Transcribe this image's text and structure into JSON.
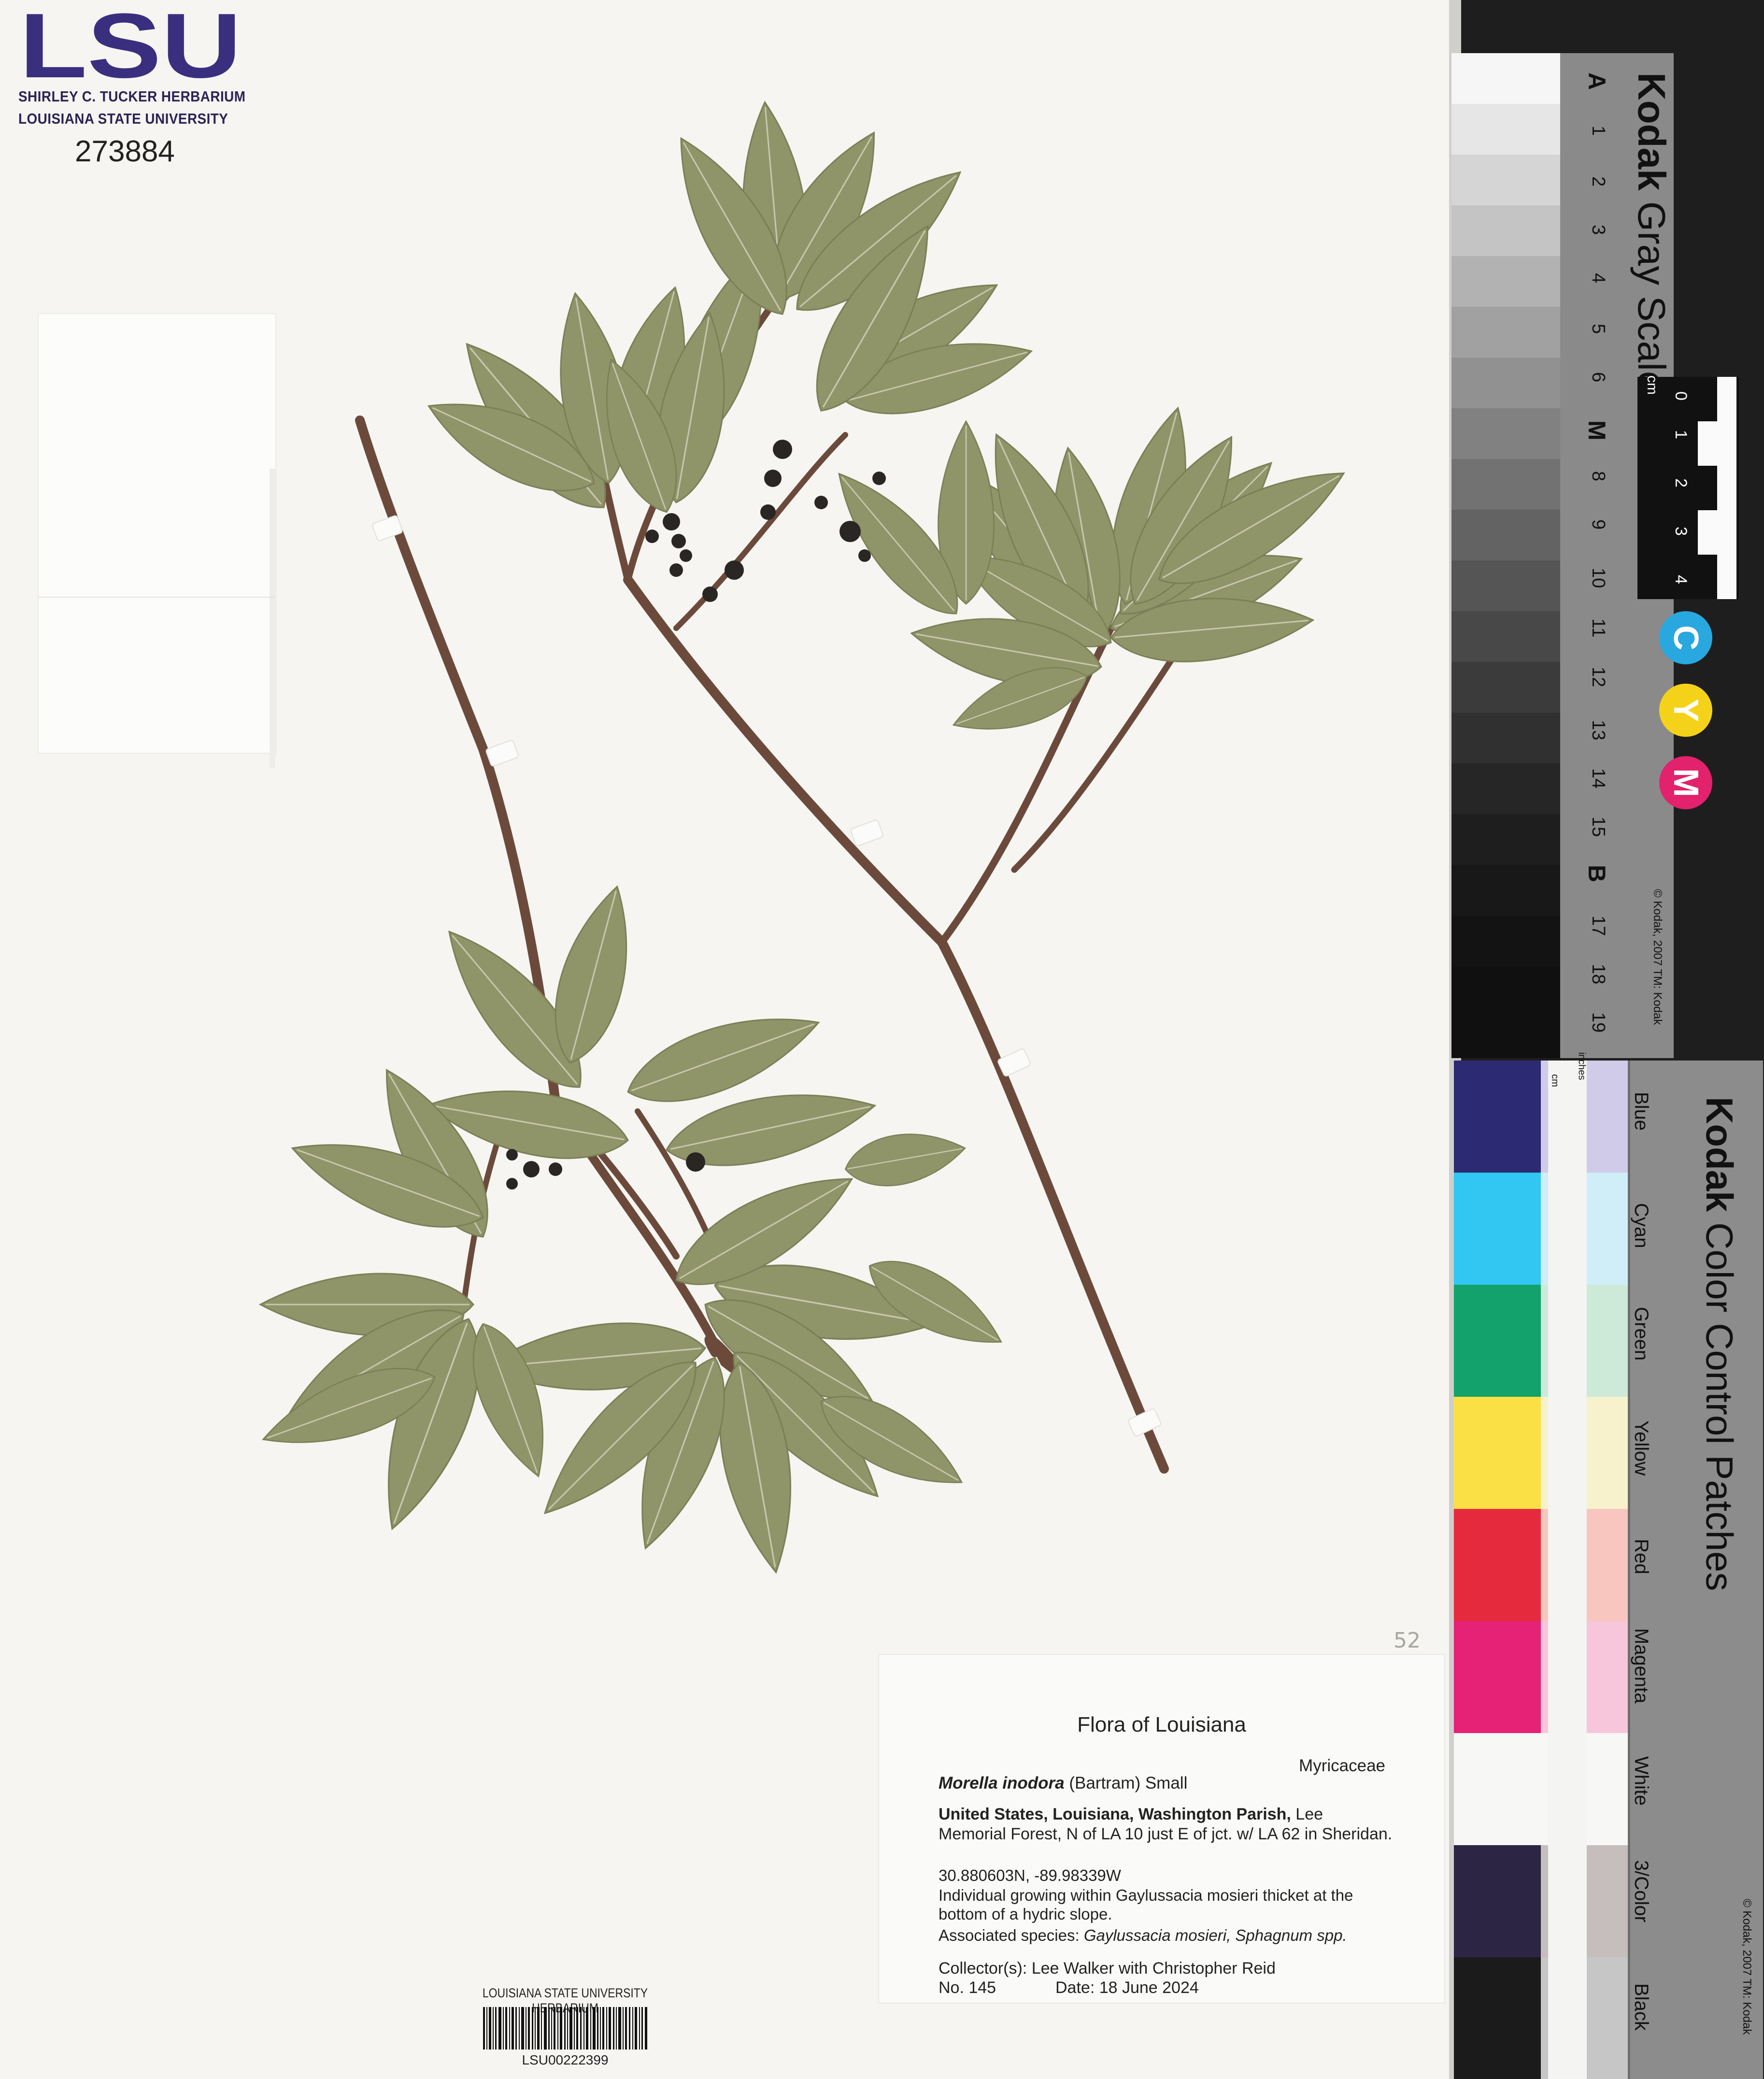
{
  "header": {
    "logo_text": "LSU",
    "herbarium_line1": "SHIRLEY C. TUCKER HERBARIUM",
    "herbarium_line2": "LOUISIANA STATE UNIVERSITY",
    "catalog_number": "273884"
  },
  "pencil_mark": "52",
  "label": {
    "title": "Flora of Louisiana",
    "family": "Myricaceae",
    "taxon_name": "Morella inodora",
    "taxon_author": "(Bartram) Small",
    "locality_bold": "United States, Louisiana, Washington Parish,",
    "locality_rest": " Lee Memorial Forest, N of LA 10 just E of jct. w/ LA 62 in Sheridan.",
    "coordinates": "30.880603N, -89.98339W",
    "habitat": "Individual growing within Gaylussacia mosieri thicket at the bottom of a hydric slope.",
    "associated_prefix": "Associated species: ",
    "associated_species": "Gaylussacia mosieri, Sphagnum spp.",
    "collector": "Collector(s):  Lee Walker with Christopher Reid",
    "number": "No. 145",
    "date": "Date: 18 June 2024"
  },
  "barcode": {
    "header": "LOUISIANA STATE UNIVERSITY HERBARIUM",
    "code": "LSU00222399"
  },
  "gray_scale_card": {
    "brand": "Kodak",
    "product": " Gray Scale",
    "markers": [
      "A",
      "1",
      "2",
      "3",
      "4",
      "5",
      "6",
      "M",
      "8",
      "9",
      "10",
      "11",
      "12",
      "13",
      "14",
      "15",
      "B",
      "17",
      "18",
      "19"
    ],
    "ruler_unit": "cm",
    "ruler_numbers": [
      "0",
      "1",
      "2",
      "3",
      "4"
    ],
    "color_dots": [
      "C",
      "Y",
      "M"
    ],
    "copyright": "© Kodak, 2007 TM: Kodak"
  },
  "color_card": {
    "brand": "Kodak",
    "product": " Color Control Patches",
    "patches": [
      "Blue",
      "Cyan",
      "Green",
      "Yellow",
      "Red",
      "Magenta",
      "White",
      "3/Color",
      "Black"
    ],
    "ruler_units": [
      "inches",
      "cm"
    ],
    "copyright": "© Kodak, 2007 TM: Kodak"
  },
  "colors": {
    "lsu_purple": "#3a2f7e",
    "leaf": "#8f9568",
    "stem": "#6b4a3c"
  }
}
